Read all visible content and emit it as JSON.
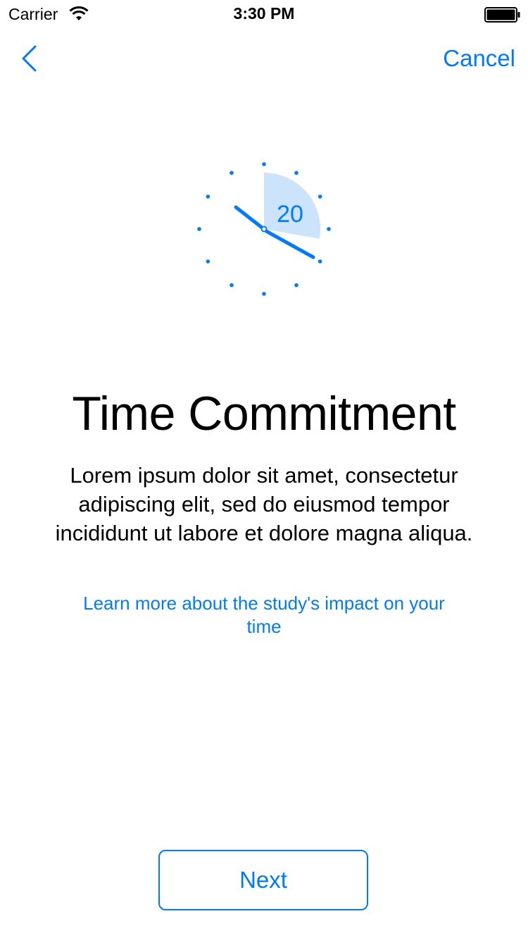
{
  "status_bar": {
    "carrier": "Carrier",
    "time": "3:30 PM"
  },
  "nav": {
    "back_icon": "chevron-left-icon",
    "cancel_label": "Cancel"
  },
  "illustration": {
    "icon": "clock-icon",
    "minutes": "20"
  },
  "content": {
    "title": "Time Commitment",
    "body": "Lorem ipsum dolor sit amet, consectetur adipiscing elit, sed do eiusmod tempor incididunt ut labore et dolore magna aliqua.",
    "learn_more": "Learn more about the study's impact on your time"
  },
  "actions": {
    "next_label": "Next"
  },
  "colors": {
    "accent": "#007aff",
    "clock_fill": "#cce4fb",
    "text": "#000000",
    "background": "#ffffff"
  }
}
